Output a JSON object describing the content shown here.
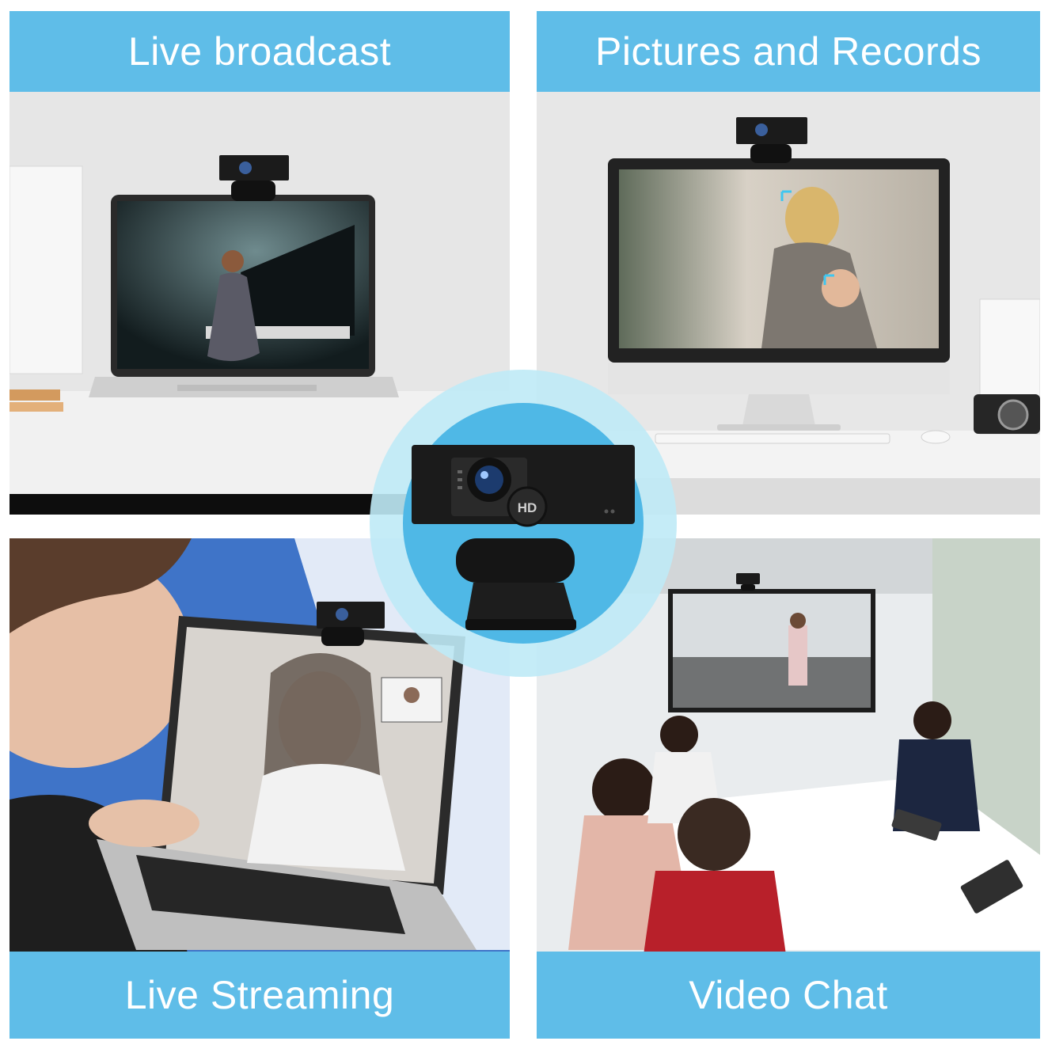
{
  "panels": {
    "top_left": {
      "title": "Live broadcast"
    },
    "top_right": {
      "title": "Pictures and Records"
    },
    "bottom_left": {
      "title": "Live Streaming"
    },
    "bottom_right": {
      "title": "Video Chat"
    }
  },
  "webcam": {
    "knob_label": "HD"
  },
  "colors": {
    "banner": "#5fbde8",
    "accent_ring": "#9fe0f3",
    "webcam_body": "#1b1b1b"
  },
  "icons": [
    "webcam-icon",
    "laptop-icon",
    "monitor-icon",
    "camera-icon"
  ]
}
